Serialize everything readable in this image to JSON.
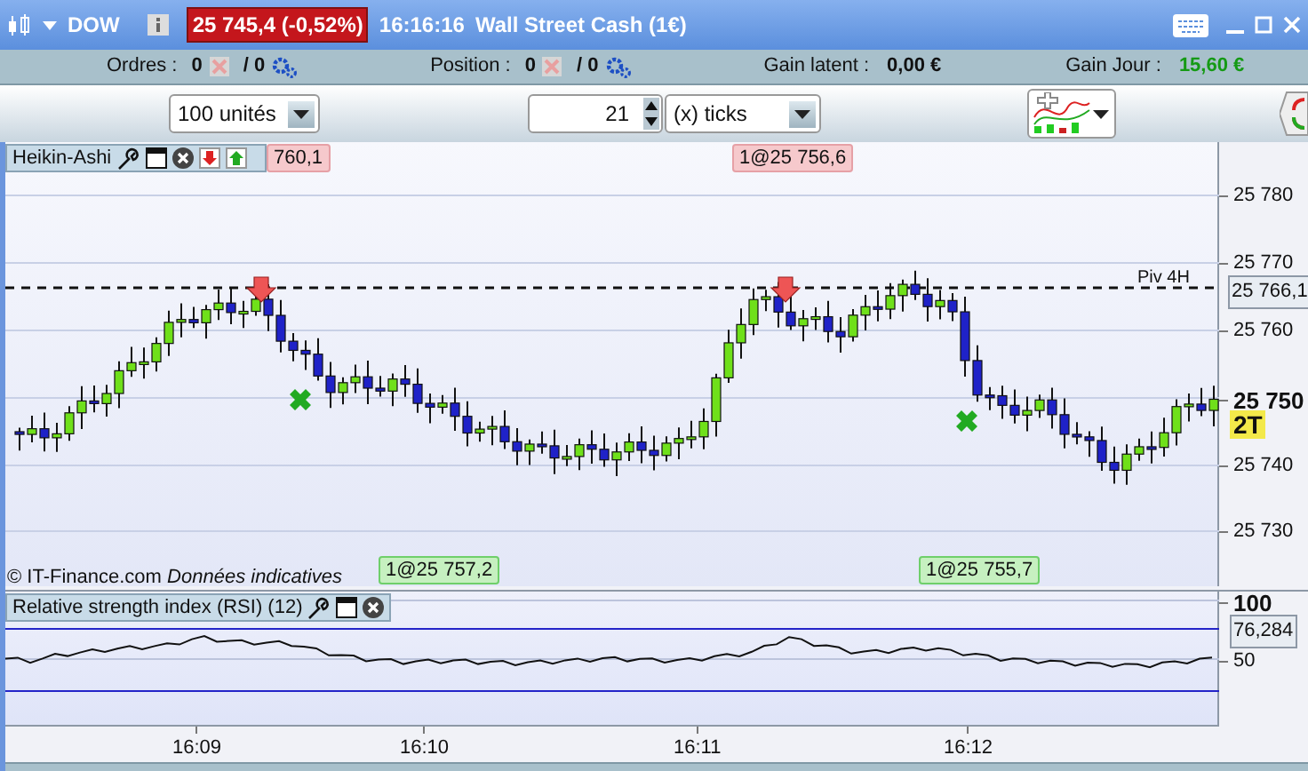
{
  "title_bar": {
    "symbol": "DOW",
    "quote": "25 745,4 (-0,52%)",
    "time": "16:16:16",
    "instrument": "Wall Street Cash (1€)"
  },
  "account": [
    {
      "kind": "counter",
      "label": "Ordres :",
      "value": "0",
      "sub_value": "/ 0"
    },
    {
      "kind": "counter",
      "label": "Position :",
      "value": "0",
      "sub_value": "/ 0"
    },
    {
      "kind": "amount",
      "label": "Gain latent :",
      "value": "0,00 €",
      "highlight": false
    },
    {
      "kind": "amount",
      "label": "Gain Jour :",
      "value": "15,60 €",
      "highlight": true
    }
  ],
  "toolbar": {
    "quantity": "100 unités",
    "period": "21",
    "unit": "(x) ticks"
  },
  "chart": {
    "indicator": "Heikin-Ashi",
    "price_ticks": [
      {
        "label": "25 780",
        "emphasized": false
      },
      {
        "label": "25 770",
        "emphasized": false
      },
      {
        "label": "25 760",
        "emphasized": false
      },
      {
        "label": "25 750",
        "emphasized": true
      },
      {
        "label": "25 740",
        "emphasized": false
      },
      {
        "label": "25 730",
        "emphasized": false
      }
    ],
    "pivot": {
      "label": "Piv 4H",
      "value": "25 766,1"
    },
    "counter": "2T",
    "orders": [
      {
        "text": "760,1",
        "kind": "sell"
      },
      {
        "text": "1@25 756,6",
        "kind": "sell"
      },
      {
        "text": "1@25 757,2",
        "kind": "buy"
      },
      {
        "text": "1@25 755,7",
        "kind": "buy"
      }
    ],
    "copyright": "© IT-Finance.com",
    "note": "Données indicatives"
  },
  "rsi": {
    "title": "Relative strength index (RSI) (12)",
    "ticks": [
      "100",
      "50"
    ],
    "value": "76,284"
  },
  "time_axis": [
    "16:09",
    "16:10",
    "16:11",
    "16:12"
  ]
}
